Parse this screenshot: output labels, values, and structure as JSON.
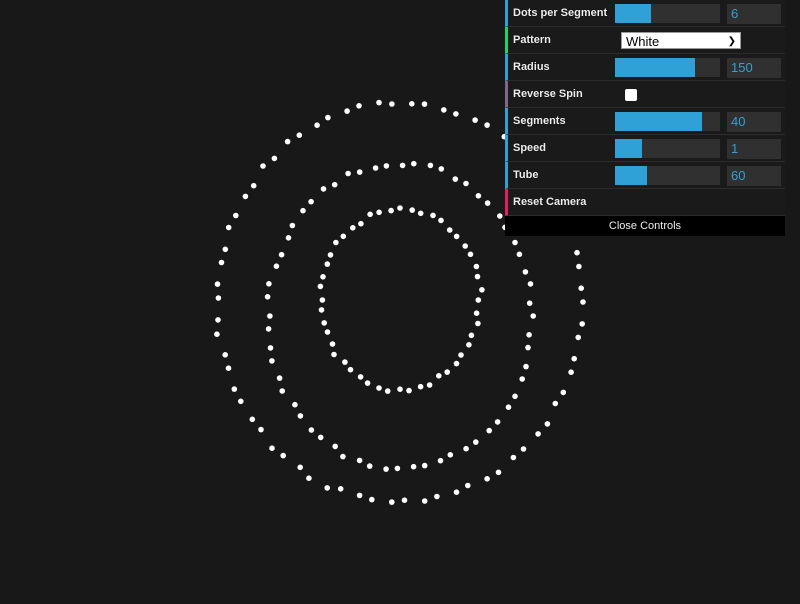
{
  "controls": [
    {
      "label": "Dots per Segment",
      "type": "slider",
      "value": "6",
      "fraction": 0.34
    },
    {
      "label": "Pattern",
      "type": "select",
      "value": "White"
    },
    {
      "label": "Radius",
      "type": "slider",
      "value": "150",
      "fraction": 0.76
    },
    {
      "label": "Reverse Spin",
      "type": "checkbox",
      "checked": false
    },
    {
      "label": "Segments",
      "type": "slider",
      "value": "40",
      "fraction": 0.83
    },
    {
      "label": "Speed",
      "type": "slider",
      "value": "1",
      "fraction": 0.26
    },
    {
      "label": "Tube",
      "type": "slider",
      "value": "60",
      "fraction": 0.3
    },
    {
      "label": "Reset Camera",
      "type": "button"
    }
  ],
  "close_label": "Close Controls",
  "colors": {
    "accent": "#2fa1d6",
    "background": "#181818",
    "dots": "#ffffff"
  }
}
